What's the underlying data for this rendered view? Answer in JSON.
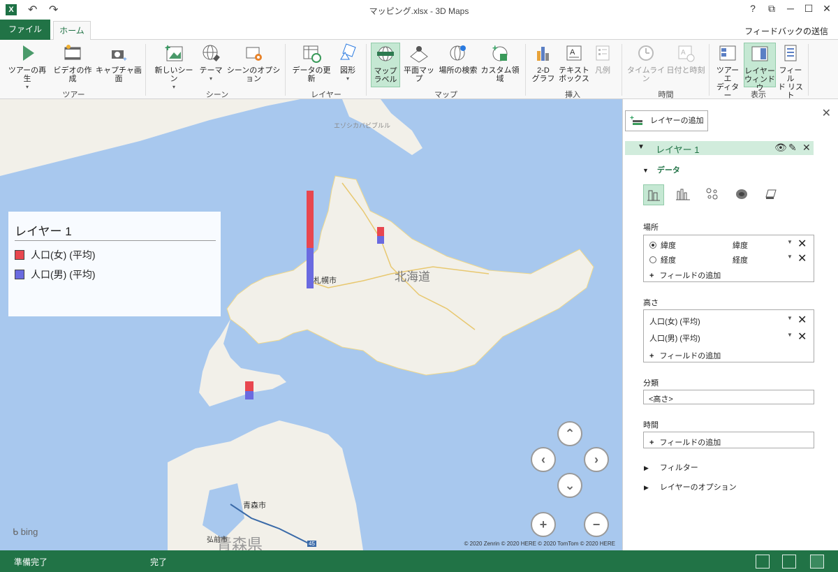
{
  "titlebar": {
    "title": "マッピング.xlsx - 3D Maps",
    "help": "?",
    "restore": "⧉",
    "minimize": "─",
    "maximize": "☐",
    "close": "✕",
    "app_icon": "X"
  },
  "tabs": {
    "file": "ファイル",
    "home": "ホーム",
    "feedback": "フィードバックの送信"
  },
  "ribbon": {
    "tour": {
      "play": "ツアーの再生",
      "video": "ビデオの作成",
      "capture": "キャプチャ画面",
      "group": "ツアー"
    },
    "scene": {
      "new_scene": "新しいシーン",
      "theme": "テーマ",
      "options": "シーンのオプション",
      "group": "シーン"
    },
    "layer": {
      "refresh": "データの更新",
      "shapes": "図形",
      "group": "レイヤー"
    },
    "map": {
      "labels": "マップ\nラベル",
      "labels_1": "マップ",
      "labels_2": "ラベル",
      "flat": "平面マップ",
      "find": "場所の検索",
      "custom": "カスタム領域",
      "group": "マップ"
    },
    "insert": {
      "chart_1": "2-D",
      "chart_2": "グラフ",
      "textbox_1": "テキスト",
      "textbox_2": "ボックス",
      "legend": "凡例",
      "group": "挿入"
    },
    "time": {
      "timeline": "タイムライン",
      "datetime": "日付と時刻",
      "group": "時間"
    },
    "view": {
      "tour_editor_1": "ツアー エ",
      "tour_editor_2": "ディター",
      "layer_pane_1": "レイヤー",
      "layer_pane_2": "ウィンドウ",
      "field_list_1": "フィール",
      "field_list_2": "ド リスト",
      "group": "表示"
    }
  },
  "map": {
    "legend": {
      "title": "レイヤー 1",
      "items": [
        {
          "label": "人口(女) (平均)",
          "color": "#e8474f"
        },
        {
          "label": "人口(男) (平均)",
          "color": "#6a6ae0"
        }
      ]
    },
    "labels": {
      "hokkaido": "北海道",
      "sapporo": "札幌市",
      "aomori_city": "青森市",
      "aomori_pref": "青森県",
      "hirosaki": "弘前市",
      "sakhalin": "エゾシカバビブルル",
      "route": "45"
    },
    "bing": "bing",
    "copyright": "© 2020 Zenrin  © 2020 HERE  © 2020 TomTom © 2020 HERE",
    "nav": {
      "up": "⌃",
      "down": "⌄",
      "left": "‹",
      "right": "›",
      "zoom_in": "+",
      "zoom_out": "−"
    }
  },
  "panel": {
    "add_layer": "レイヤーの追加",
    "layer_name": "レイヤー 1",
    "data_section": "データ",
    "location_label": "場所",
    "location_rows": [
      {
        "field": "緯度",
        "type": "緯度",
        "selected": true
      },
      {
        "field": "経度",
        "type": "経度",
        "selected": false
      }
    ],
    "add_field": "フィールドの追加",
    "height_label": "高さ",
    "height_rows": [
      "人口(女) (平均)",
      "人口(男) (平均)"
    ],
    "category_label": "分類",
    "category_value": "<高さ>",
    "time_label": "時間",
    "filter": "フィルター",
    "layer_options": "レイヤーのオプション"
  },
  "status": {
    "ready": "準備完了",
    "done": "完了"
  },
  "colors": {
    "accent": "#217346",
    "map_water": "#a8c8ee",
    "land": "#f2f0e9"
  }
}
